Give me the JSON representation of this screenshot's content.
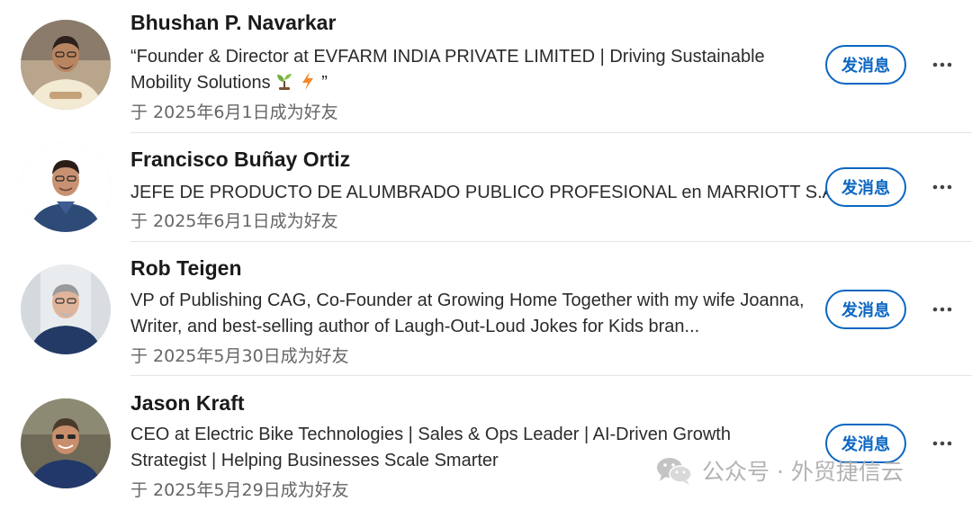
{
  "connections": [
    {
      "name": "Bhushan P. Navarkar",
      "headline_open": "“Founder & Director at EVFARM INDIA PRIVATE LIMITED | Driving Sustainable Mobility Solutions ",
      "headline_close": " ”",
      "emoji_names": [
        "seedling-emoji",
        "lightning-emoji"
      ],
      "connected": "于 2025年6月1日成为好友",
      "message_label": "发消息",
      "more_icon": "more-horizontal-icon"
    },
    {
      "name": "Francisco Buñay Ortiz",
      "headline": "JEFE DE PRODUCTO DE ALUMBRADO PUBLICO PROFESIONAL en MARRIOTT S.A.",
      "connected": "于 2025年6月1日成为好友",
      "message_label": "发消息",
      "more_icon": "more-horizontal-icon"
    },
    {
      "name": "Rob Teigen",
      "headline": "VP of Publishing CAG, Co-Founder at Growing Home Together with my wife Joanna,  Writer, and best-selling author of Laugh-Out-Loud Jokes for Kids bran...",
      "connected": "于 2025年5月30日成为好友",
      "message_label": "发消息",
      "more_icon": "more-horizontal-icon"
    },
    {
      "name": "Jason Kraft",
      "headline": "CEO at Electric Bike Technologies | Sales & Ops Leader | AI-Driven Growth Strategist | Helping Businesses Scale Smarter",
      "connected": "于 2025年5月29日成为好友",
      "message_label": "发消息",
      "more_icon": "more-horizontal-icon"
    }
  ],
  "watermark": {
    "text": "公众号 · 外贸捷信云",
    "icon": "wechat-icon"
  },
  "colors": {
    "accent": "#0a66c2",
    "secondary_text": "#666666",
    "divider": "#e6e6e6",
    "watermark": "#b3b3b3"
  }
}
